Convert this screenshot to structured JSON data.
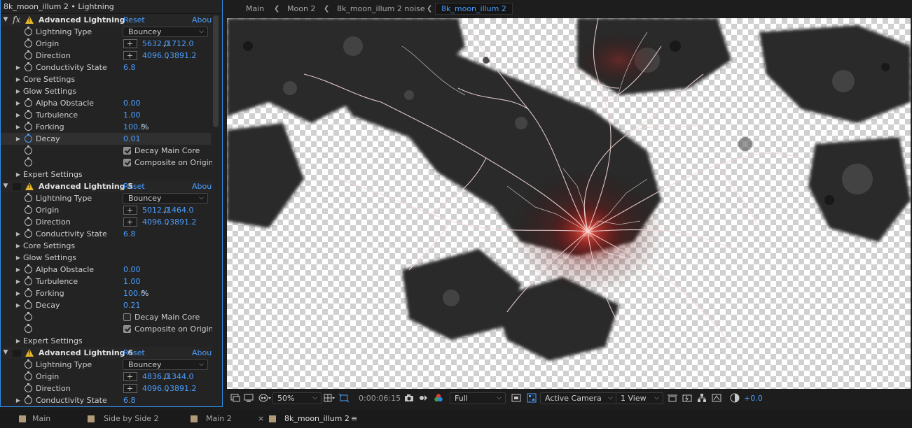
{
  "effect_panel": {
    "title": "8k_moon_illum 2 • Lightning",
    "reset_label": "Reset",
    "about_label": "About",
    "prop_labels": {
      "lightning_type": "Lightning Type",
      "origin": "Origin",
      "direction": "Direction",
      "conductivity_state": "Conductivity State",
      "core_settings": "Core Settings",
      "glow_settings": "Glow Settings",
      "alpha_obstacle": "Alpha Obstacle",
      "turbulence": "Turbulence",
      "forking": "Forking",
      "decay": "Decay",
      "decay_main_core": "Decay Main Core",
      "composite_on_origin": "Composite on Origin",
      "expert_settings": "Expert Settings"
    },
    "effects": [
      {
        "name": "Advanced Lightning",
        "has_fx": true,
        "lightning_type": "Bouncey",
        "origin_x": "5632.0",
        "origin_y": "1712.0",
        "direction_x": "4096.0",
        "direction_y": "3891.2",
        "conductivity_state": "6.8",
        "alpha_obstacle": "0.00",
        "turbulence": "1.00",
        "forking": "100.0",
        "forking_unit": "%",
        "decay": "0.01",
        "decay_main_core": true,
        "composite_on_origin": true
      },
      {
        "name": "Advanced Lightning 5",
        "has_fx": false,
        "lightning_type": "Bouncey",
        "origin_x": "5012.0",
        "origin_y": "1464.0",
        "direction_x": "4096.0",
        "direction_y": "3891.2",
        "conductivity_state": "6.8",
        "alpha_obstacle": "0.00",
        "turbulence": "1.00",
        "forking": "100.0",
        "forking_unit": "%",
        "decay": "0.21",
        "decay_main_core": false,
        "composite_on_origin": true
      },
      {
        "name": "Advanced Lightning 6",
        "has_fx": false,
        "lightning_type": "Bouncey",
        "origin_x": "4836.0",
        "origin_y": "1344.0",
        "direction_x": "4096.0",
        "direction_y": "3891.2",
        "conductivity_state": "6.8"
      }
    ]
  },
  "viewer": {
    "breadcrumbs": [
      "Main",
      "Moon 2",
      "8k_moon_illum 2 noise",
      "8k_moon_illum 2"
    ],
    "active_breadcrumb": "8k_moon_illum 2",
    "toolbar": {
      "zoom": "50%",
      "timecode": "0:00:06:15",
      "resolution": "Full",
      "camera": "Active Camera",
      "views": "1 View",
      "exposure": "+0.0"
    }
  },
  "bottom_tabs": [
    {
      "label": "Main",
      "close": false,
      "active": false
    },
    {
      "label": "Side by Side 2",
      "close": false,
      "active": false
    },
    {
      "label": "Main 2",
      "close": false,
      "active": false
    },
    {
      "label": "8k_moon_illum 2",
      "close": true,
      "active": true
    }
  ],
  "colors": {
    "accent": "#4a9eff",
    "panel_border": "#2d8ceb",
    "warning": "#e8b92a",
    "label_swatch": "#b09a78",
    "lightning_glow": "#ff4a3a"
  }
}
